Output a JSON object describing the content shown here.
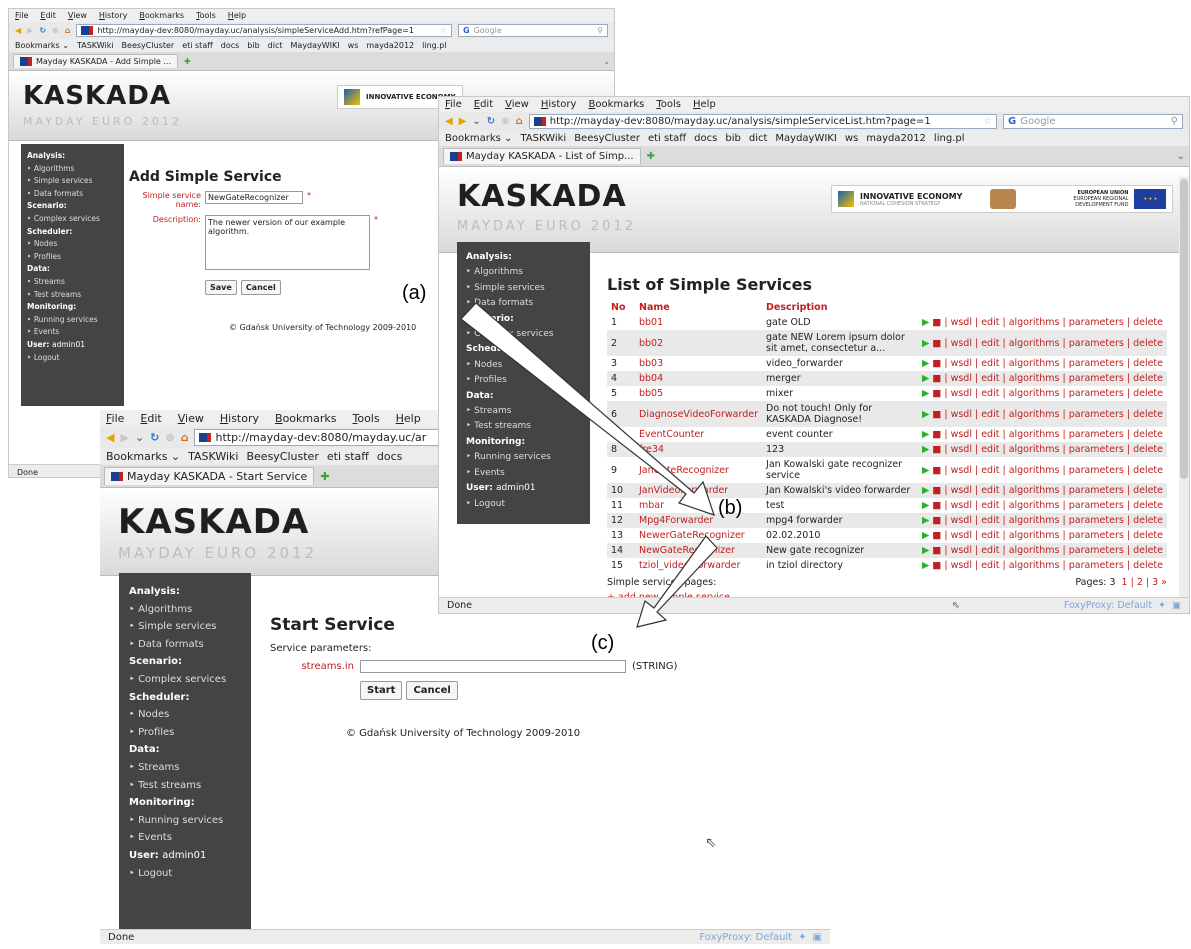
{
  "browser": {
    "menu": [
      "File",
      "Edit",
      "View",
      "History",
      "Bookmarks",
      "Tools",
      "Help"
    ],
    "bookmarks": [
      "Bookmarks ⌄",
      "TASKWiki",
      "BeesyCluster",
      "eti staff",
      "docs",
      "bib",
      "dict",
      "MaydayWIKI",
      "ws",
      "mayda2012",
      "ling.pl"
    ],
    "search_placeholder": "Google",
    "status_done": "Done",
    "foxyproxy": "FoxyProxy: Default"
  },
  "app": {
    "logo": "KASKADA",
    "logo_sub": "MAYDAY EURO 2012",
    "sponsor": "INNOVATIVE ECONOMY",
    "sponsor_sub": "NATIONAL COHESION STRATEGY",
    "eu": "EUROPEAN UNION",
    "eu_sub": "EUROPEAN REGIONAL DEVELOPMENT FUND",
    "footer": "© Gdańsk University of Technology 2009-2010"
  },
  "sidebar": {
    "analysis": "Analysis:",
    "algorithms": "Algorithms",
    "simple_services": "Simple services",
    "data_formats": "Data formats",
    "scenario": "Scenario:",
    "complex_services": "Complex services",
    "scheduler": "Scheduler:",
    "nodes": "Nodes",
    "profiles": "Profiles",
    "data": "Data:",
    "streams": "Streams",
    "test_streams": "Test streams",
    "monitoring": "Monitoring:",
    "running_services": "Running services",
    "events": "Events",
    "user_label": "User:",
    "user_name": "admin01",
    "logout": "Logout"
  },
  "win_a": {
    "url": "http://mayday-dev:8080/mayday.uc/analysis/simpleServiceAdd.htm?refPage=1",
    "tab": "Mayday KASKADA - Add Simple ...",
    "title": "Add Simple Service",
    "name_label": "Simple service name:",
    "name_value": "NewGateRecognizer",
    "desc_label": "Description:",
    "desc_value": "The newer version of our example algorithm.",
    "required": "*",
    "save": "Save",
    "cancel": "Cancel"
  },
  "win_b": {
    "url": "http://mayday-dev:8080/mayday.uc/analysis/simpleServiceList.htm?page=1",
    "tab": "Mayday KASKADA - List of Simp...",
    "title": "List of Simple Services",
    "columns": [
      "No",
      "Name",
      "Description"
    ],
    "actions": "| wsdl | edit | algorithms | parameters | delete",
    "rows": [
      {
        "no": "1",
        "name": "bb01",
        "desc": "gate OLD"
      },
      {
        "no": "2",
        "name": "bb02",
        "desc": "gate NEW Lorem ipsum dolor sit amet, consectetur a..."
      },
      {
        "no": "3",
        "name": "bb03",
        "desc": "video_forwarder"
      },
      {
        "no": "4",
        "name": "bb04",
        "desc": "merger"
      },
      {
        "no": "5",
        "name": "bb05",
        "desc": "mixer"
      },
      {
        "no": "6",
        "name": "DiagnoseVideoForwarder",
        "desc": "Do not touch! Only for KASKADA Diagnose!"
      },
      {
        "no": "7",
        "name": "EventCounter",
        "desc": "event counter"
      },
      {
        "no": "8",
        "name": "fre34",
        "desc": "123"
      },
      {
        "no": "9",
        "name": "JanGateRecognizer",
        "desc": "Jan Kowalski gate recognizer service"
      },
      {
        "no": "10",
        "name": "JanVideoForwarder",
        "desc": "Jan Kowalski's video forwarder"
      },
      {
        "no": "11",
        "name": "mbar",
        "desc": "test"
      },
      {
        "no": "12",
        "name": "Mpg4Forwarder",
        "desc": "mpg4 forwarder"
      },
      {
        "no": "13",
        "name": "NewerGateRecognizer",
        "desc": "02.02.2010"
      },
      {
        "no": "14",
        "name": "NewGateRecognizer",
        "desc": "New gate recognizer"
      },
      {
        "no": "15",
        "name": "tziol_video_forwarder",
        "desc": "in tziol directory"
      }
    ],
    "summary": "Simple services pages:",
    "pages_label": "Pages: 3",
    "pages": "1 | 2 | 3 »",
    "add_link": "+ add new simple service"
  },
  "win_c": {
    "url": "http://mayday-dev:8080/mayday.uc/ar",
    "tab": "Mayday KASKADA - Start Service",
    "title": "Start Service",
    "params_label": "Service parameters:",
    "param_name": "streams.in",
    "param_type": "(STRING)",
    "start": "Start",
    "cancel": "Cancel"
  },
  "labels": {
    "a": "(a)",
    "b": "(b)",
    "c": "(c)"
  }
}
